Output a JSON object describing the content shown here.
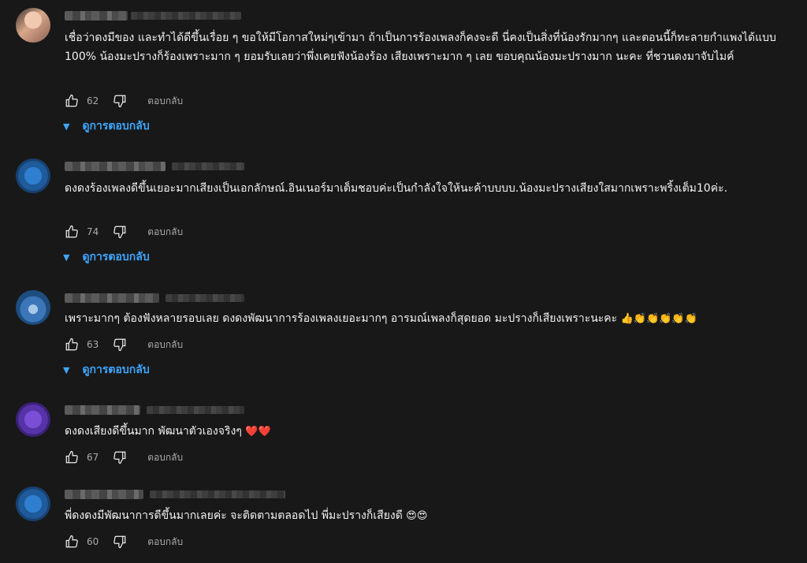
{
  "reply_label": "ตอบกลับ",
  "view_replies_label": "ดูการตอบกลับ",
  "comments": [
    {
      "text": "เชื่อว่าดงมีของ และทำได้ดีขึ้นเรื่อย ๆ ขอให้มีโอกาสใหม่ๆเข้ามา ถ้าเป็นการร้องเพลงก็คงจะดี นี่คงเป็นสิ่งที่น้องรักมากๆ และตอนนี้ก็ทะลายกำแพงได้แบบ 100% น้องมะปรางก็ร้องเพราะมาก ๆ ยอมรับเลยว่าพึ่งเคยฟังน้องร้อง เสียงเพราะมาก ๆ เลย ขอบคุณน้องมะปรางมาก นะคะ ที่ชวนดงมาจับไมค์",
      "likes": "62",
      "has_replies": true
    },
    {
      "text": "ดงดงร้องเพลงดีขึ้นเยอะมากเสียงเป็นเอกลักษณ์.อินเนอร์มาเต็มชอบค่ะเป็นกำลังใจให้นะค้าบบบบ.น้องมะปรางเสียงใสมากเพราะพริ้งเต็ม10ค่ะ.",
      "likes": "74",
      "has_replies": true
    },
    {
      "text": "เพราะมากๆ ต้องฟังหลายรอบเลย ดงดงพัฒนาการร้องเพลงเยอะมากๆ อารมณ์เพลงก็สุดยอด มะปรางก็เสียงเพราะนะคะ",
      "emoji": "👍👏👏👏👏👏",
      "likes": "63",
      "has_replies": true
    },
    {
      "text": "ดงดงเสียงดีขึ้นมาก พัฒนาตัวเองจริงๆ",
      "emoji": "❤️❤️",
      "likes": "67",
      "has_replies": false
    },
    {
      "text": "พี่ดงดงมีพัฒนาการดีขึ้นมากเลยค่ะ จะติดตามตลอดไป พี่มะปรางก็เสียงดี",
      "emoji": "😍😍",
      "likes": "60",
      "has_replies": false
    }
  ]
}
